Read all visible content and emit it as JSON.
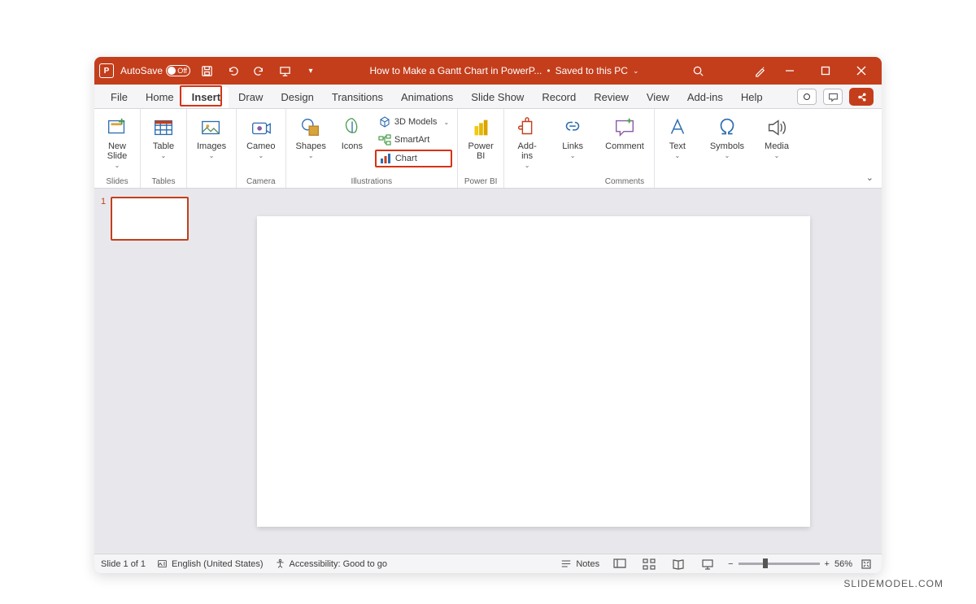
{
  "titlebar": {
    "autosave_label": "AutoSave",
    "autosave_state": "Off",
    "doc_title": "How to Make a Gantt Chart in PowerP...",
    "save_status": "Saved to this PC"
  },
  "tabs": {
    "file": "File",
    "home": "Home",
    "insert": "Insert",
    "draw": "Draw",
    "design": "Design",
    "transitions": "Transitions",
    "animations": "Animations",
    "slideshow": "Slide Show",
    "record": "Record",
    "review": "Review",
    "view": "View",
    "addins": "Add-ins",
    "help": "Help"
  },
  "ribbon": {
    "groups": {
      "slides": "Slides",
      "tables": "Tables",
      "camera": "Camera",
      "illustrations": "Illustrations",
      "powerbi": "Power BI",
      "comments": "Comments"
    },
    "buttons": {
      "new_slide": "New\nSlide",
      "table": "Table",
      "images": "Images",
      "cameo": "Cameo",
      "shapes": "Shapes",
      "icons": "Icons",
      "models3d": "3D Models",
      "smartart": "SmartArt",
      "chart": "Chart",
      "powerbi": "Power\nBI",
      "addins": "Add-\nins",
      "links": "Links",
      "comment": "Comment",
      "text": "Text",
      "symbols": "Symbols",
      "media": "Media"
    }
  },
  "thumbs": {
    "slide1_num": "1"
  },
  "statusbar": {
    "slide_of": "Slide 1 of 1",
    "language": "English (United States)",
    "accessibility": "Accessibility: Good to go",
    "notes": "Notes",
    "zoom": "56%"
  },
  "watermark": "SLIDEMODEL.COM"
}
